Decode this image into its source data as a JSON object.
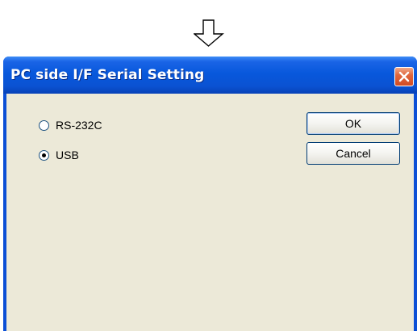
{
  "page": {
    "arrow_icon": "down-arrow-icon"
  },
  "dialog": {
    "title": "PC side I/F Serial Setting",
    "close_icon": "close-icon",
    "options": [
      {
        "label": "RS-232C",
        "checked": false
      },
      {
        "label": "USB",
        "checked": true
      }
    ],
    "buttons": {
      "ok_label": "OK",
      "cancel_label": "Cancel"
    }
  },
  "colors": {
    "titlebar": "#0a52d2",
    "client_bg": "#ece9d8",
    "close_bg": "#d24b22"
  }
}
